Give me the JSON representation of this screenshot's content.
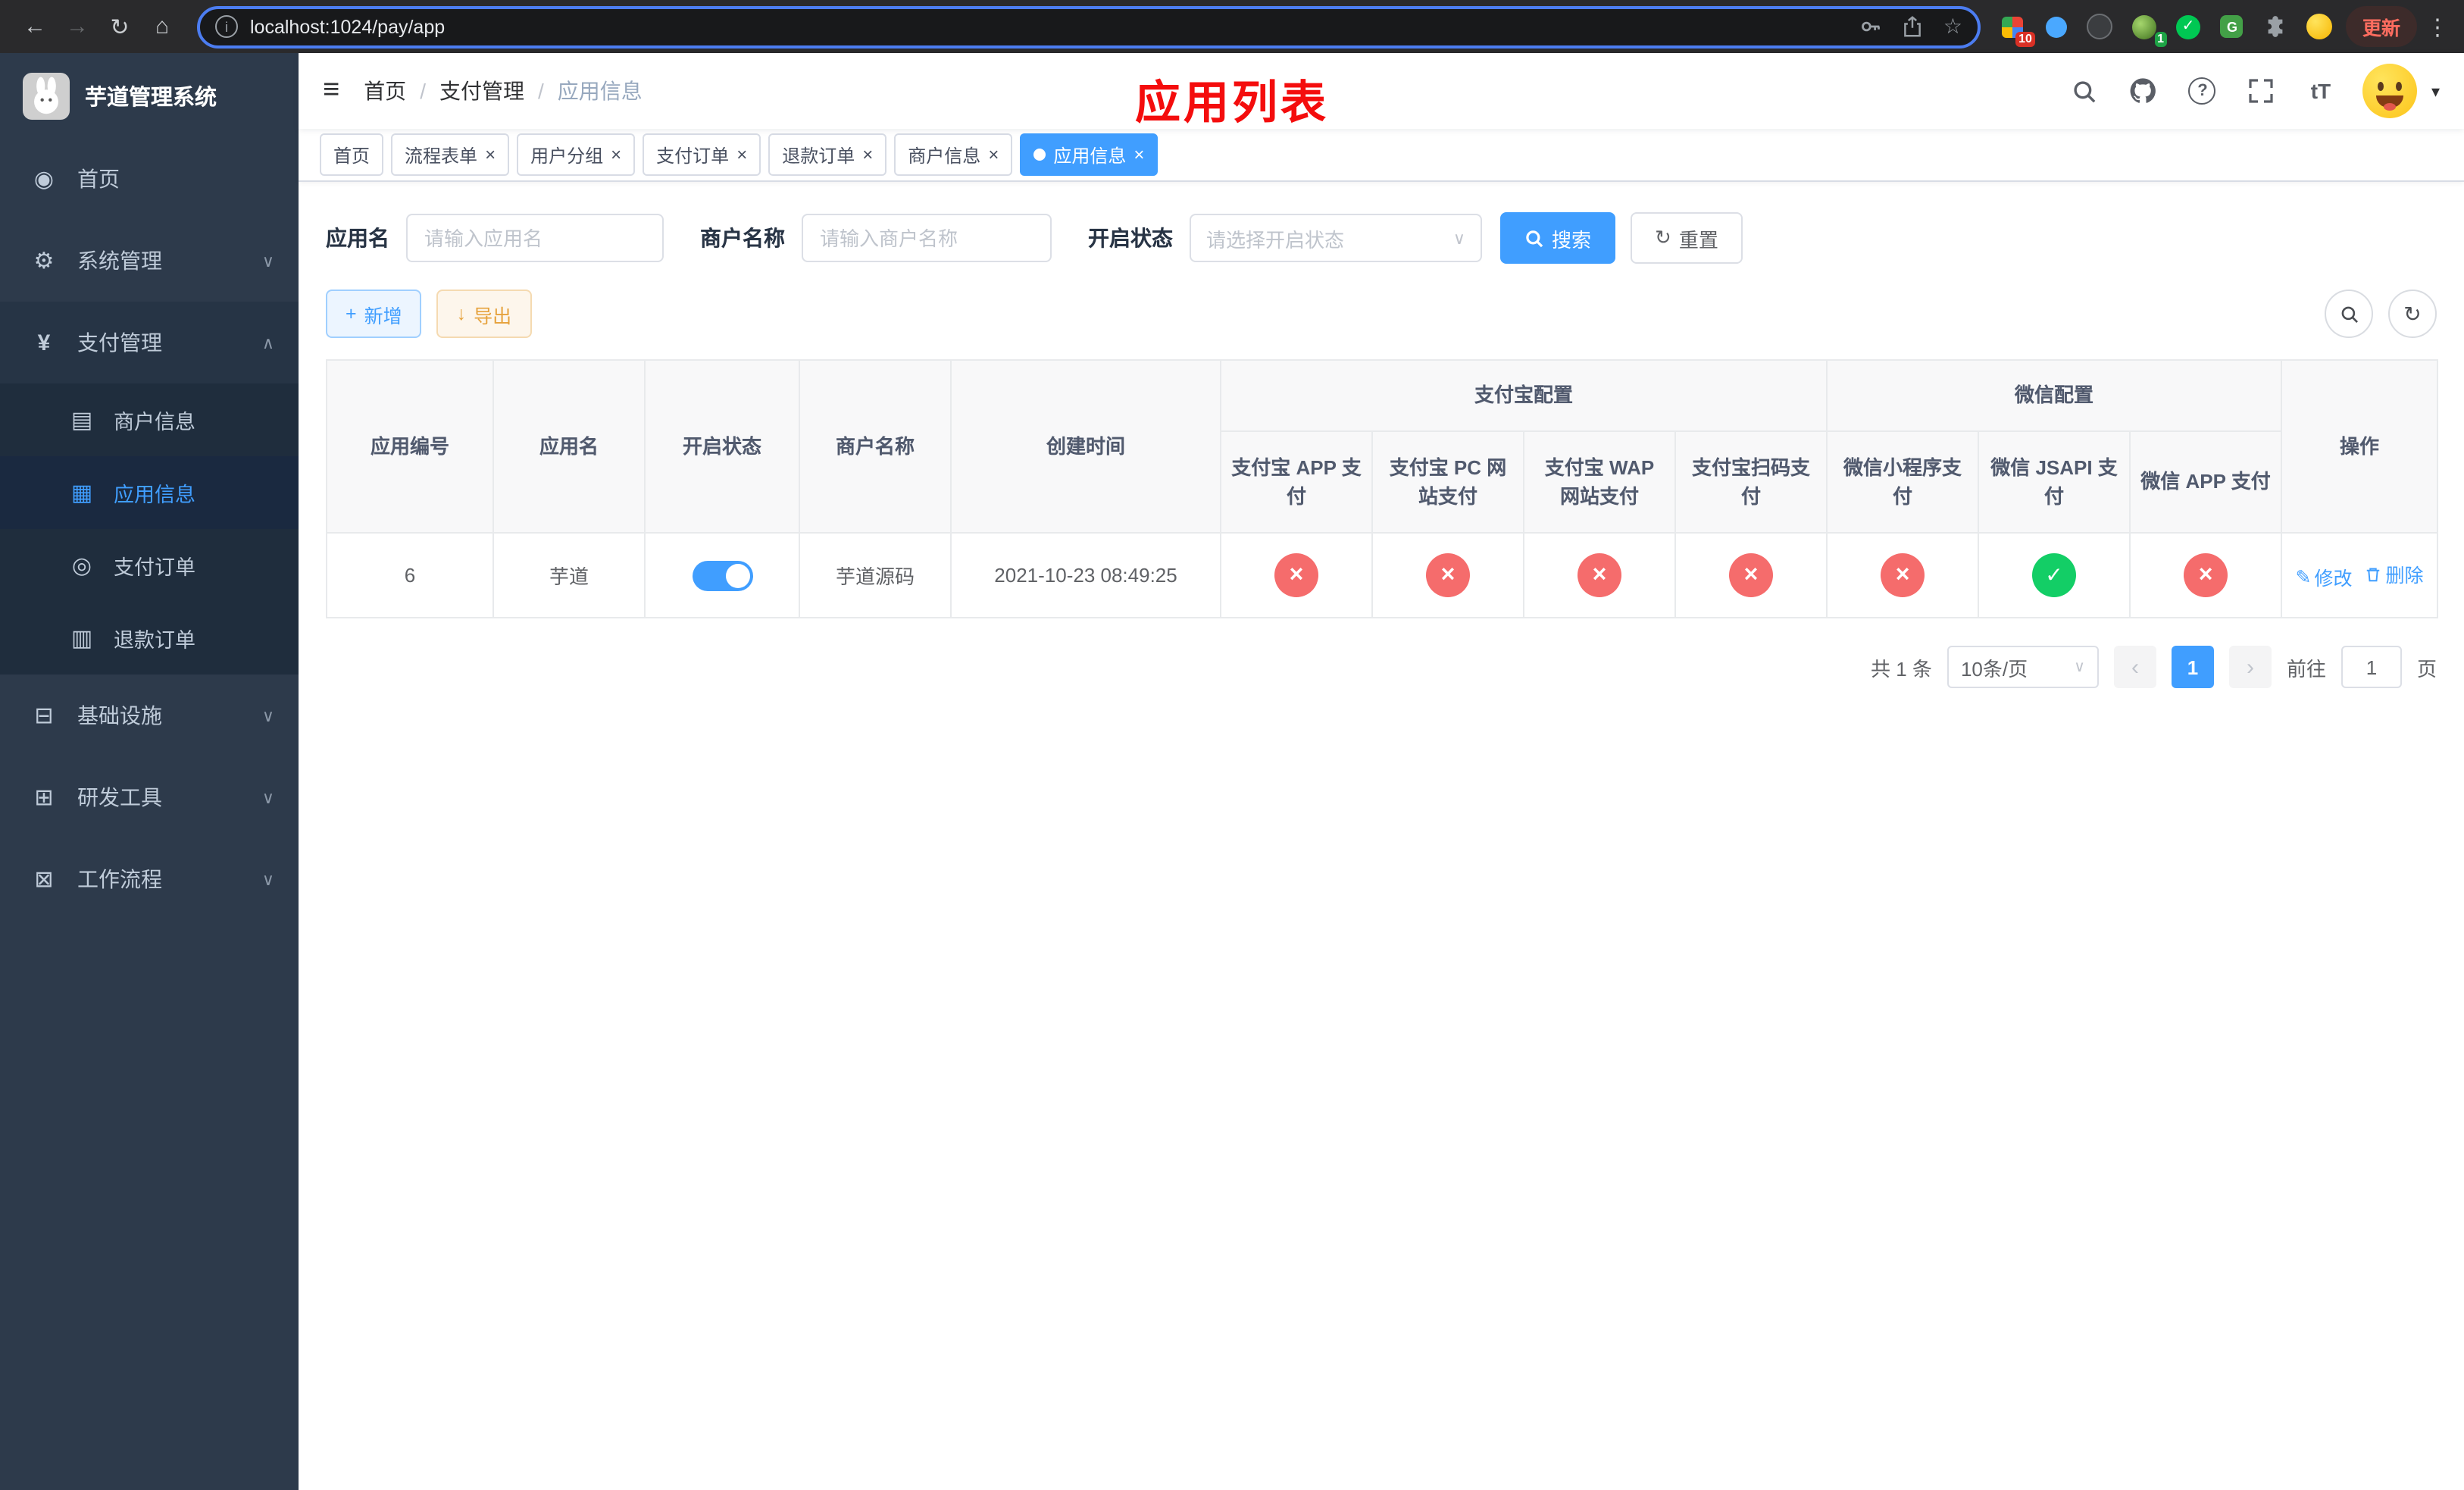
{
  "colors": {
    "accent": "#409eff",
    "success": "#13ce66",
    "error": "#f56c6c",
    "warning": "#e6a23c",
    "annotation": "#f40d0d",
    "sidebar_bg": "#2d3a4b",
    "submenu_bg": "#1f2d3d"
  },
  "browser": {
    "url": "localhost:1024/pay/app",
    "update_label": "更新",
    "ext_badge_grid": "10",
    "ext_badge_avatar": "1"
  },
  "icons": {
    "back": "←",
    "forward": "→",
    "reload": "↻",
    "home": "⌂",
    "info": "i",
    "bookmark": "☆",
    "kebab": "⋮",
    "check": "✓",
    "hamburger": "≡",
    "question": "?",
    "font_size": "tT",
    "caret_down": "▾",
    "dashboard": "◉",
    "gear": "⚙",
    "yen": "¥",
    "merchant": "▤",
    "app_grid": "▦",
    "order": "◎",
    "refund": "▥",
    "infra": "⊟",
    "tools": "⊞",
    "workflow": "⊠",
    "chevron_down": "∨",
    "chevron_up": "∧",
    "close": "×",
    "plus": "+",
    "download": "↓",
    "prev": "‹",
    "next": "›",
    "edit": "✎",
    "ext_glyph": "G"
  },
  "sidebar": {
    "title": "芋道管理系统",
    "items": {
      "home": "首页",
      "system": "系统管理",
      "payment": "支付管理",
      "merchant": "商户信息",
      "app_info": "应用信息",
      "pay_order": "支付订单",
      "refund_order": "退款订单",
      "infra": "基础设施",
      "dev_tools": "研发工具",
      "workflow": "工作流程"
    }
  },
  "navbar": {
    "breadcrumb": {
      "home": "首页",
      "payment": "支付管理",
      "current": "应用信息",
      "separator": "/"
    },
    "annotation": "应用列表"
  },
  "tabs": [
    {
      "label": "首页"
    },
    {
      "label": "流程表单"
    },
    {
      "label": "用户分组"
    },
    {
      "label": "支付订单"
    },
    {
      "label": "退款订单"
    },
    {
      "label": "商户信息"
    },
    {
      "label": "应用信息"
    }
  ],
  "filters": {
    "app_name": {
      "label": "应用名",
      "placeholder": "请输入应用名"
    },
    "merchant": {
      "label": "商户名称",
      "placeholder": "请输入商户名称"
    },
    "status": {
      "label": "开启状态",
      "placeholder": "请选择开启状态"
    },
    "search": "搜索",
    "reset": "重置"
  },
  "toolbar": {
    "add": "新增",
    "export": "导出"
  },
  "table": {
    "groups": {
      "alipay": "支付宝配置",
      "wechat": "微信配置"
    },
    "columns": [
      "应用编号",
      "应用名",
      "开启状态",
      "商户名称",
      "创建时间",
      "支付宝 APP 支付",
      "支付宝 PC 网站支付",
      "支付宝 WAP 网站支付",
      "支付宝扫码支付",
      "微信小程序支付",
      "微信 JSAPI 支付",
      "微信 APP 支付",
      "操作"
    ],
    "rows": [
      {
        "id": "6",
        "name": "芋道",
        "status": "on",
        "merchant": "芋道源码",
        "created": "2021-10-23 08:49:25",
        "configs": [
          "no",
          "no",
          "no",
          "no",
          "no",
          "yes",
          "no"
        ],
        "edit": "修改",
        "delete": "删除"
      }
    ]
  },
  "pagination": {
    "total": "共 1 条",
    "page_size": "10条/页",
    "page": "1",
    "goto": "前往",
    "goto_value": "1",
    "unit": "页"
  }
}
